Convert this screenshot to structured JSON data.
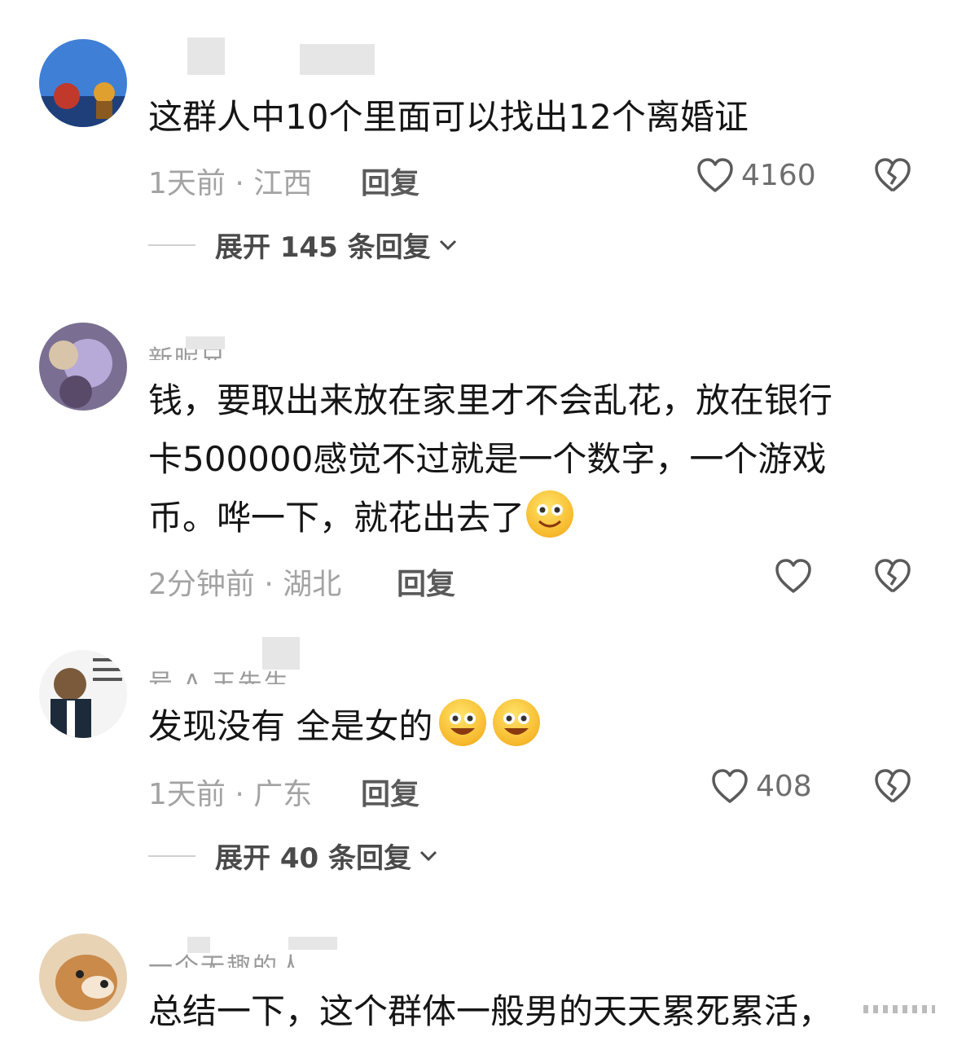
{
  "comments": [
    {
      "username": "",
      "text": "这群人中10个里面可以找出12个离婚证",
      "time": "1天前",
      "location": "江西",
      "reply_label": "回复",
      "likes": "4160",
      "expand_label": "展开 145 条回复"
    },
    {
      "username": "新昵兄",
      "text_line1": "钱，要取出来放在家里才不会乱花，放在银行",
      "text_line2": "卡500000感觉不过就是一个数字，一个游戏",
      "text_line3": "币。哗一下，就花出去了",
      "time": "2分钟前",
      "location": "湖北",
      "reply_label": "回复",
      "likes": ""
    },
    {
      "username": "号 A 王先生",
      "text": "发现没有 全是女的",
      "time": "1天前",
      "location": "广东",
      "reply_label": "回复",
      "likes": "408",
      "expand_label": "展开 40 条回复"
    },
    {
      "username": "一个无趣的人",
      "text": "总结一下，这个群体一般男的天天累死累活，"
    }
  ],
  "icons": {
    "like": "heart-outline-icon",
    "dislike": "broken-heart-icon",
    "expand": "chevron-down-icon",
    "emoji": "smile-emoji-icon"
  },
  "colors": {
    "text": "#151515",
    "meta": "#a3a3a3",
    "reply": "#5a5a5a"
  }
}
